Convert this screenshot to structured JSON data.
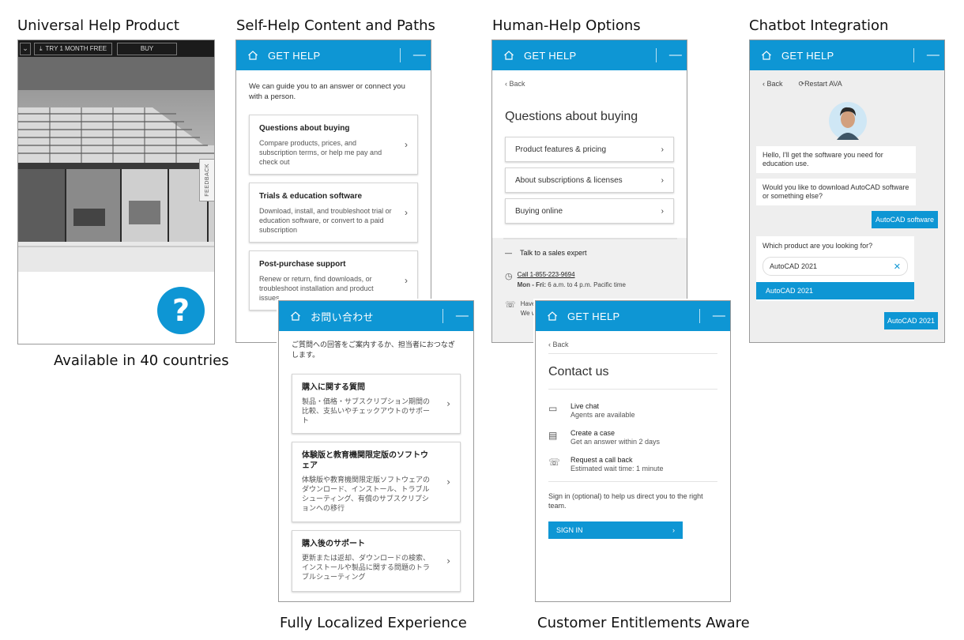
{
  "sections": {
    "universal": "Universal Help Product",
    "selfhelp": "Self-Help Content and Paths",
    "human": "Human-Help Options",
    "chatbot": "Chatbot Integration"
  },
  "captions": {
    "countries": "Available in 40 countries",
    "localized": "Fully Localized Experience",
    "entitlements": "Customer Entitlements Aware"
  },
  "phone": {
    "trial_label": "TRY 1 MONTH FREE",
    "buy_label": "BUY",
    "feedback_label": "FEEDBACK",
    "help_fab": "?"
  },
  "selfhelp": {
    "header": "GET HELP",
    "intro": "We can guide you to an answer or connect you with a person.",
    "cards": [
      {
        "title": "Questions about buying",
        "desc": "Compare products, prices, and subscription terms, or help me pay and check out"
      },
      {
        "title": "Trials & education software",
        "desc": "Download, install, and troubleshoot trial or education software, or convert to a paid subscription"
      },
      {
        "title": "Post-purchase support",
        "desc": "Renew or return, find downloads, or troubleshoot installation and product issues"
      }
    ]
  },
  "japanese": {
    "header": "お問い合わせ",
    "intro": "ご質問への回答をご案内するか、担当者におつなぎします。",
    "cards": [
      {
        "title": "購入に関する質問",
        "desc": "製品・価格・サブスクリプション期間の比較、支払いやチェックアウトのサポート"
      },
      {
        "title": "体験版と教育機関限定版のソフトウェア",
        "desc": "体験版や教育機関限定版ソフトウェアのダウンロード、インストール、トラブルシューティング、有償のサブスクリプションへの移行"
      },
      {
        "title": "購入後のサポート",
        "desc": "更新または返却、ダウンロードの検索、インストールや製品に関する問題のトラブルシューティング"
      }
    ]
  },
  "human": {
    "header": "GET HELP",
    "back": "‹ Back",
    "heading": "Questions about buying",
    "options": [
      "Product features & pricing",
      "About subscriptions & licenses",
      "Buying online"
    ],
    "talk": "Talk to a sales expert",
    "phone": "Call 1-855-223-9694",
    "hours_bold": "Mon - Fri:",
    "hours": "6 a.m. to 4 p.m. Pacific time",
    "partial1": "Have s",
    "partial2": "We wi"
  },
  "contact": {
    "header": "GET HELP",
    "back": "‹ Back",
    "heading": "Contact us",
    "rows": [
      {
        "title": "Live chat",
        "sub": "Agents are available"
      },
      {
        "title": "Create a case",
        "sub": "Get an answer within 2 days"
      },
      {
        "title": "Request a call back",
        "sub": "Estimated wait time: 1 minute"
      }
    ],
    "signin_note": "Sign in (optional) to help us direct you to the right team.",
    "signin_label": "SIGN IN"
  },
  "chatbot": {
    "header": "GET HELP",
    "back": "‹ Back",
    "restart": "Restart AVA",
    "msg1": "Hello, I'll get the software you need for education use.",
    "msg2": "Would you like to download AutoCAD software or something else?",
    "reply1": "AutoCAD software",
    "msg3": "Which product are you looking for?",
    "search_value": "AutoCAD 2021",
    "suggestion": "AutoCAD 2021",
    "reply2": "AutoCAD 2021"
  },
  "colors": {
    "accent": "#0e96d4"
  }
}
